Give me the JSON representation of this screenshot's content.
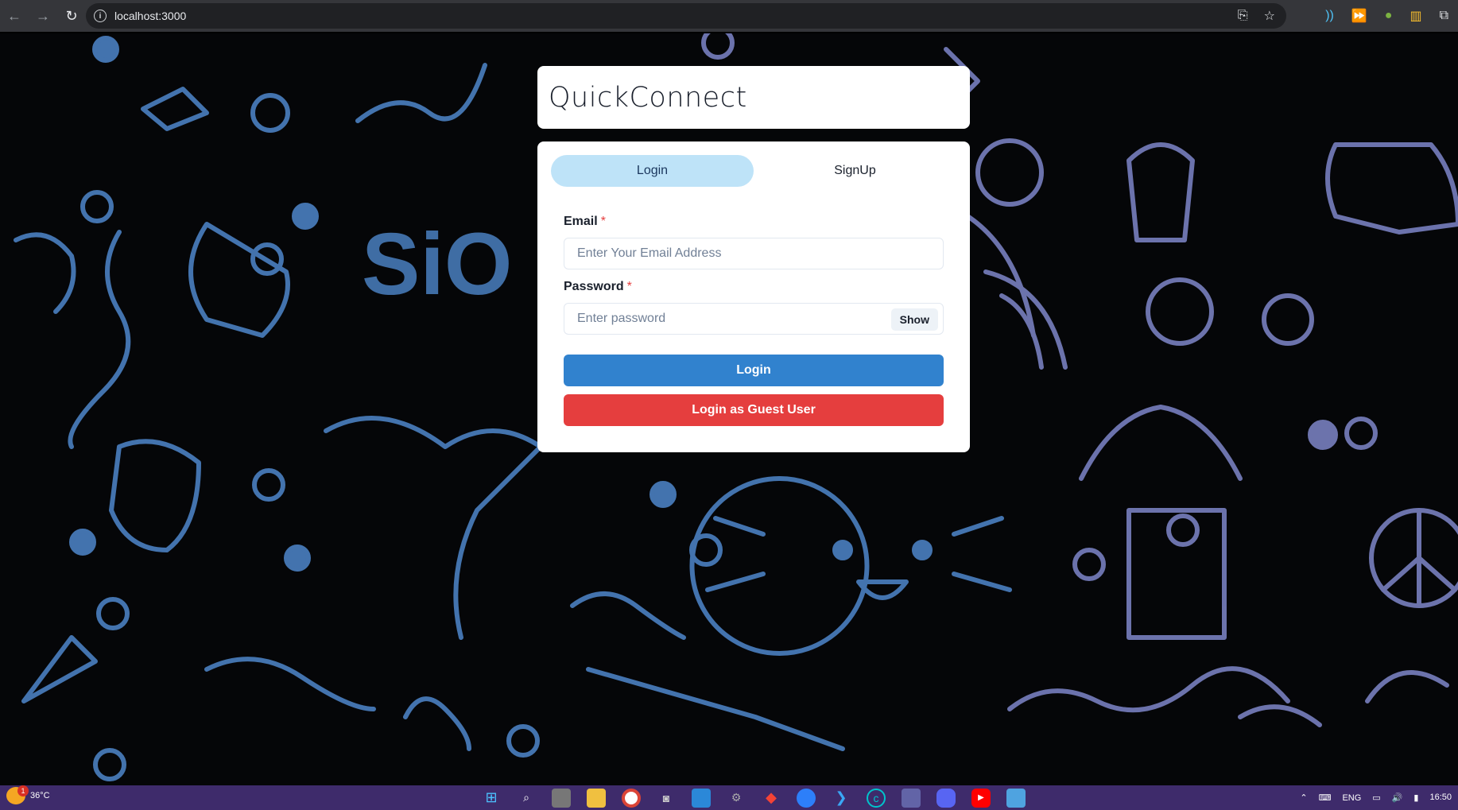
{
  "browser": {
    "url": "localhost:3000",
    "back_icon": "arrow-left-icon",
    "forward_icon": "arrow-right-icon",
    "reload_icon": "reload-icon"
  },
  "app": {
    "title": "QuickConnect",
    "tabs": [
      {
        "label": "Login",
        "selected": true
      },
      {
        "label": "SignUp",
        "selected": false
      }
    ],
    "email": {
      "label": "Email",
      "required_mark": "*",
      "placeholder": "Enter Your Email Address",
      "value": ""
    },
    "password": {
      "label": "Password",
      "required_mark": "*",
      "placeholder": "Enter password",
      "value": "",
      "toggle_label": "Show"
    },
    "login_button": "Login",
    "guest_button": "Login as Guest User",
    "colors": {
      "tab_selected_bg": "#bee3f8",
      "login_button": "#3182ce",
      "guest_button": "#e53e3e"
    }
  },
  "taskbar": {
    "weather_temp": "36°C",
    "weather_badge": "1",
    "language": "ENG",
    "time": "16:50"
  }
}
